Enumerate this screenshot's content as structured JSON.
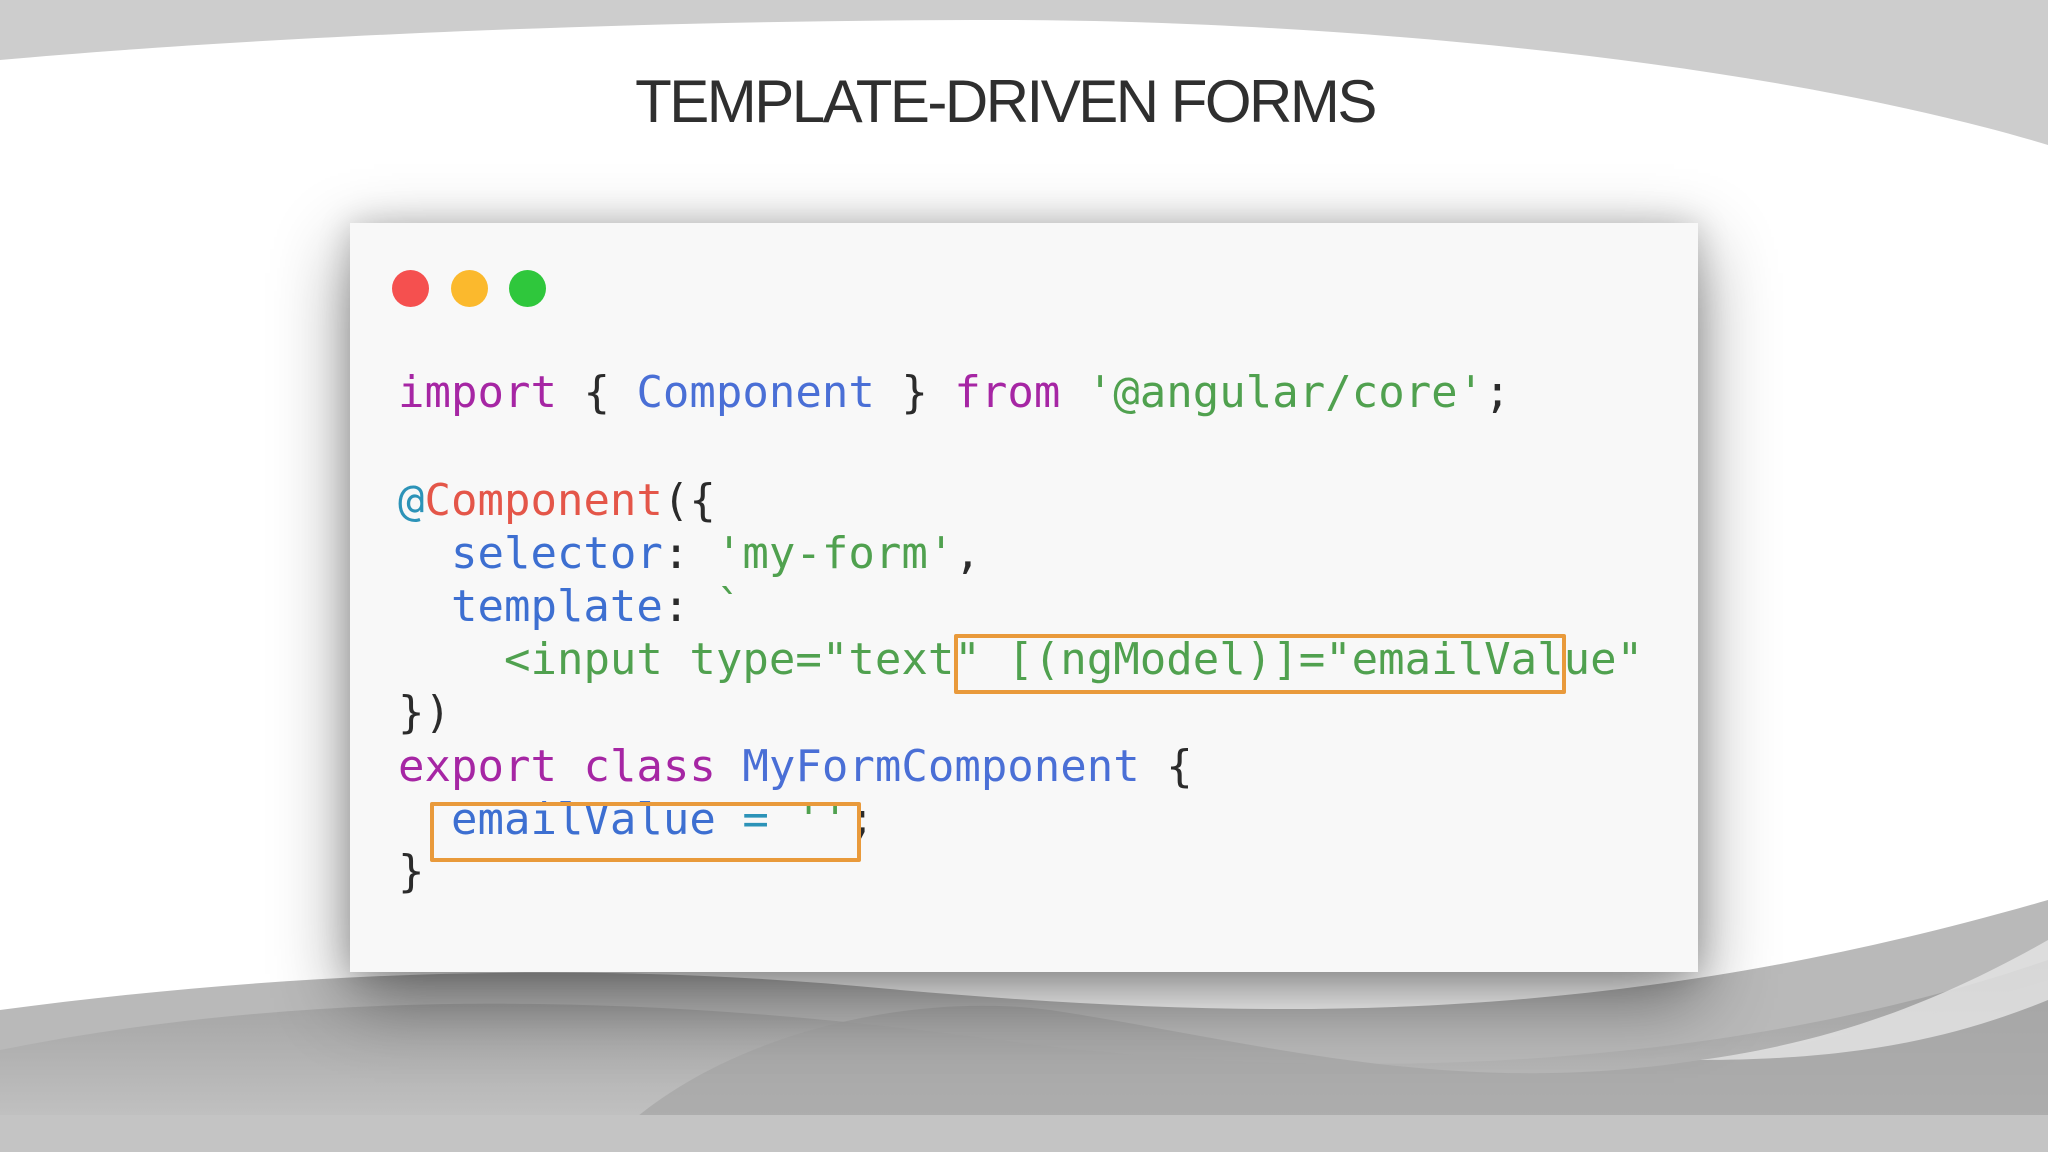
{
  "slide": {
    "title": "TEMPLATE-DRIVEN FORMS"
  },
  "window": {
    "controls": [
      "close",
      "minimize",
      "maximize"
    ]
  },
  "code": {
    "line1": {
      "import": "import",
      "brace_open": " { ",
      "component": "Component",
      "brace_close": " } ",
      "from": "from",
      "space": " ",
      "module": "'@angular/core'",
      "semi": ";"
    },
    "line2": {
      "at": "@",
      "decorator": "Component",
      "open": "({"
    },
    "line3": {
      "indent": "  ",
      "key": "selector",
      "colon": ": ",
      "value": "'my-form'",
      "comma": ","
    },
    "line4": {
      "indent": "  ",
      "key": "template",
      "colon": ": ",
      "backtick": "`"
    },
    "line5": {
      "indent": "    ",
      "tag": "<input type=\"text\" ",
      "binding": "[(ngModel)]=\"emailValue\""
    },
    "line6": {
      "close": "})"
    },
    "line7": {
      "export": "export",
      "space1": " ",
      "class": "class",
      "space2": " ",
      "name": "MyFormComponent",
      "brace": " {"
    },
    "line8": {
      "indent": "  ",
      "prop": "emailValue",
      "assign": " = ",
      "value": "''",
      "semi": ";"
    },
    "line9": {
      "close": "}"
    }
  },
  "colors": {
    "keyword": "#a626a4",
    "class_name": "#4a6fd6",
    "string": "#50a14f",
    "decorator_at": "#2c93b8",
    "decorator_name": "#e45649",
    "highlight_border": "#e99a3b",
    "close_button": "#f5504f",
    "minimize_button": "#fbb92d",
    "maximize_button": "#2fc73c"
  }
}
